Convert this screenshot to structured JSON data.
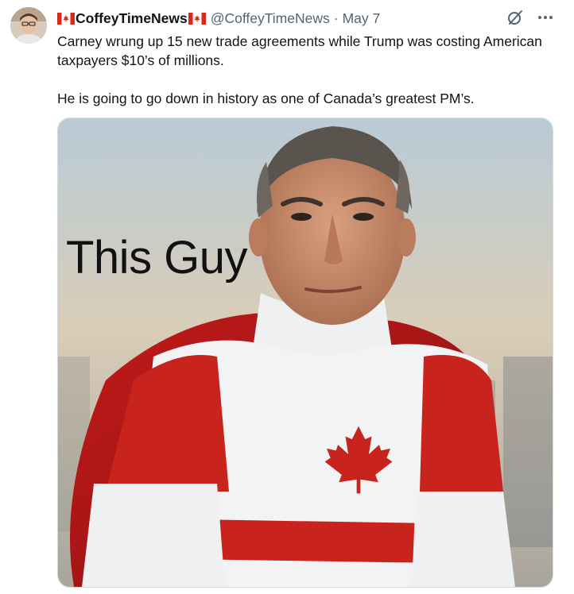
{
  "tweet": {
    "display_name": "CoffeyTimeNews",
    "handle": "@CoffeyTimeNews",
    "separator": "·",
    "date": "May 7",
    "text_paragraphs": [
      "Carney wrung up 15 new trade agreements while Trump was costing American taxpayers $10’s of millions.",
      "He is going to go down in history as one of Canada’s greatest PM’s."
    ],
    "media": {
      "overlay_text": "This Guy"
    }
  },
  "icons": [
    "canada-flag-icon",
    "grok-icon",
    "more-icon",
    "maple-leaf-icon"
  ],
  "colors": {
    "flag_red": "#d52b1e",
    "text_primary": "#0f1419",
    "text_secondary": "#536471",
    "border": "#cfd9de"
  }
}
